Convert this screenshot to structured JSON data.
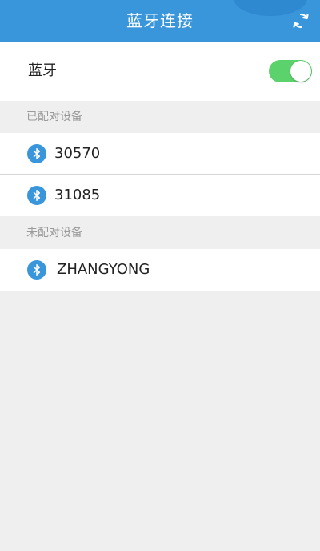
{
  "header": {
    "title": "蓝牙连接",
    "refresh_icon": "refresh-icon",
    "background_color": "#3a96db"
  },
  "bluetooth": {
    "label": "蓝牙",
    "enabled": true,
    "toggle_color": "#5bd26c"
  },
  "paired": {
    "header": "已配对设备",
    "devices": [
      {
        "name": "30570",
        "icon": "bluetooth-icon"
      },
      {
        "name": "31085",
        "icon": "bluetooth-icon"
      }
    ]
  },
  "unpaired": {
    "header": "未配对设备",
    "devices": [
      {
        "name": "ZHANGYONG",
        "icon": "bluetooth-icon"
      }
    ]
  },
  "colors": {
    "bluetooth_icon": "#3a96db",
    "page_background": "#efefef"
  }
}
